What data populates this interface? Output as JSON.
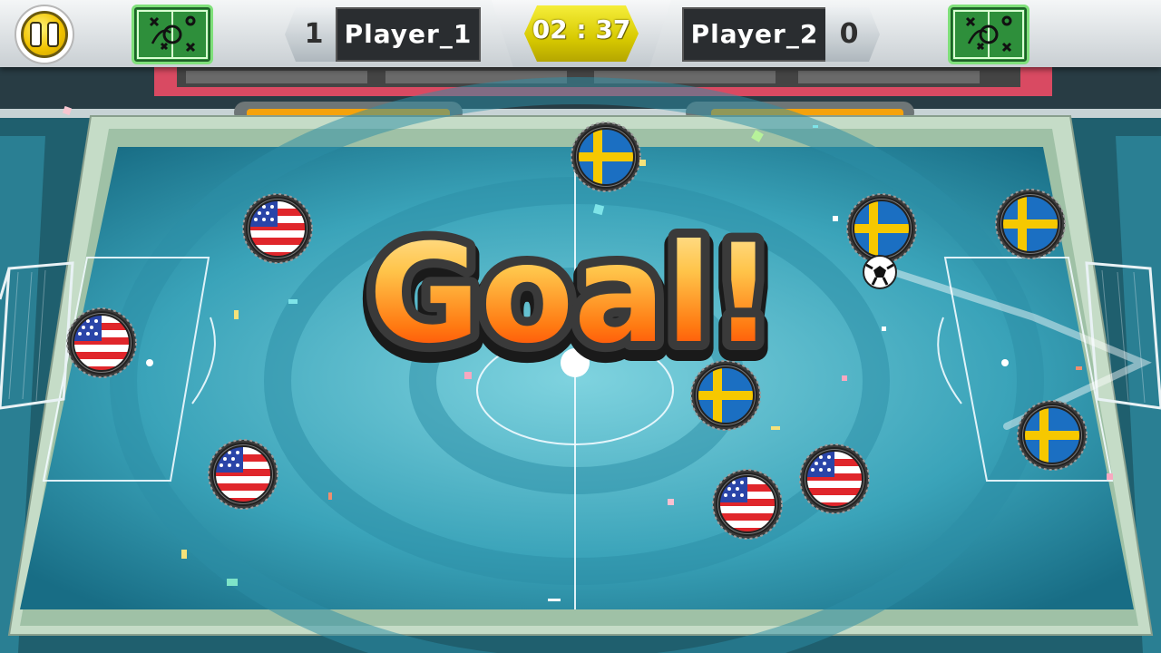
{
  "hud": {
    "pause_icon": "pause-icon",
    "tactics_icon": "tactics-board-icon",
    "player1": {
      "name": "Player_1",
      "score": "1"
    },
    "player2": {
      "name": "Player_2",
      "score": "0"
    },
    "timer": "02 : 37"
  },
  "banner": {
    "text": "Goal!"
  },
  "teams": {
    "player1_flag": "usa-flag",
    "player2_flag": "sweden-flag"
  },
  "colors": {
    "pitch": "#4fb6c9",
    "timer": "#e4d600",
    "goal_gradient_top": "#ffe38a",
    "goal_gradient_bottom": "#ff3a00"
  }
}
